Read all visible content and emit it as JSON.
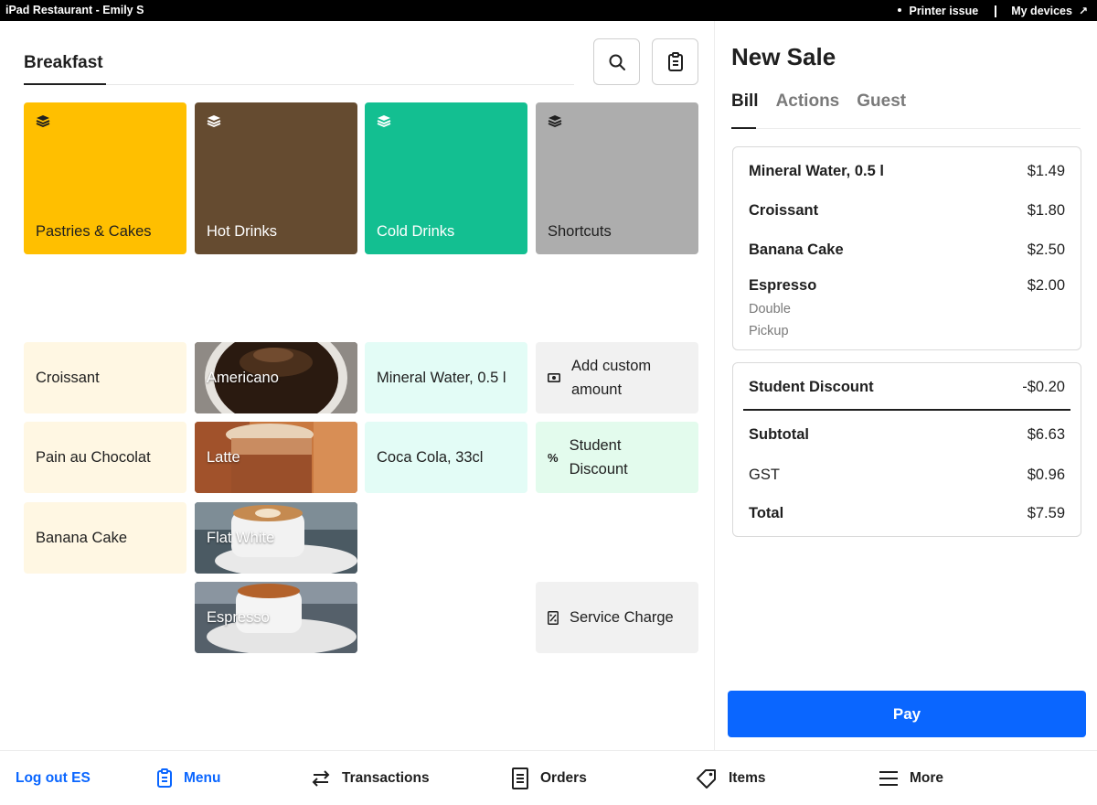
{
  "statusbar": {
    "title": "iPad Restaurant - Emily S",
    "printer_issue": "Printer issue",
    "my_devices": "My devices",
    "my_devices_arrow": "↗"
  },
  "menu": {
    "category_tab": "Breakfast",
    "categories": [
      {
        "label": "Pastries & Cakes",
        "color": "#ffbf00"
      },
      {
        "label": "Hot Drinks",
        "color": "#654b30"
      },
      {
        "label": "Cold Drinks",
        "color": "#13bf91"
      },
      {
        "label": "Shortcuts",
        "color": "#adadad"
      }
    ],
    "pastries": [
      "Croissant",
      "Pain au Chocolat",
      "Banana Cake"
    ],
    "hot_drinks": [
      "Americano",
      "Latte",
      "Flat White",
      "Espresso"
    ],
    "cold_drinks": [
      "Mineral Water, 0.5 l",
      "Coca Cola, 33cl"
    ],
    "shortcuts": {
      "add_custom_line1": "Add custom",
      "add_custom_line2": "amount",
      "student_line1": "Student",
      "student_line2": "Discount",
      "service_charge": "Service Charge",
      "percent_glyph": "%"
    },
    "tile_colors": {
      "pastry": "#fff7e3",
      "cold": "#e3fcf6",
      "custom": "#f1f1f1",
      "discount": "#e3fbed",
      "service": "#f1f1f1"
    }
  },
  "sale": {
    "title": "New Sale",
    "tabs": [
      "Bill",
      "Actions",
      "Guest"
    ],
    "items": [
      {
        "name": "Mineral Water, 0.5 l",
        "price": "$1.49"
      },
      {
        "name": "Croissant",
        "price": "$1.80"
      },
      {
        "name": "Banana Cake",
        "price": "$2.50"
      },
      {
        "name": "Espresso",
        "price": "$2.00"
      }
    ],
    "espresso_modifiers": [
      "Double",
      "Pickup"
    ],
    "discount": {
      "name": "Student Discount",
      "amount": "-$0.20"
    },
    "subtotal": {
      "label": "Subtotal",
      "value": "$6.63"
    },
    "gst": {
      "label": "GST",
      "value": "$0.96"
    },
    "total": {
      "label": "Total",
      "value": "$7.59"
    },
    "pay_label": "Pay"
  },
  "nav": {
    "logout": "Log out ES",
    "menu": "Menu",
    "transactions": "Transactions",
    "orders": "Orders",
    "items": "Items",
    "more": "More"
  },
  "colors": {
    "accent": "#0a66ff"
  }
}
